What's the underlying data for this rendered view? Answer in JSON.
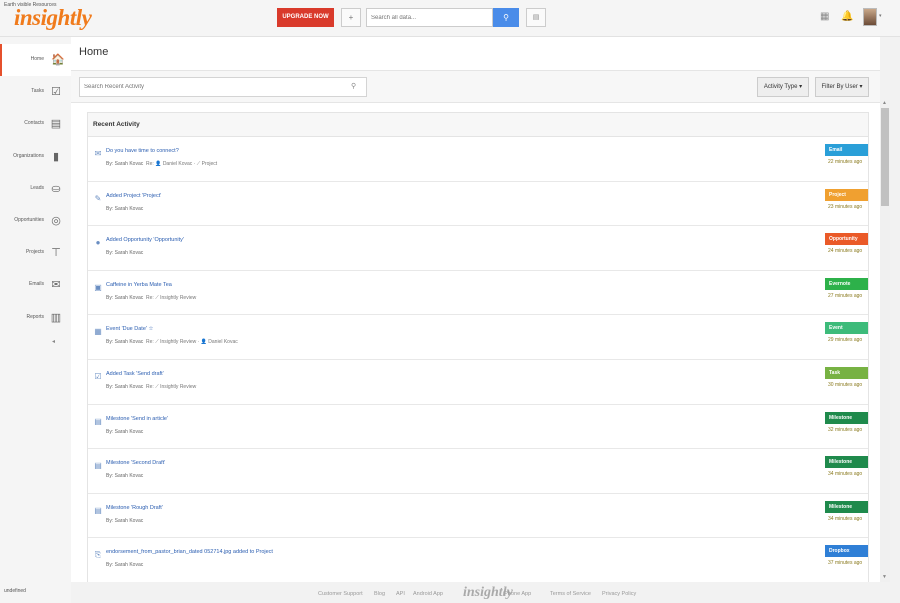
{
  "app": {
    "logo_text": "insightly",
    "top_caption": "Earth visible Resources",
    "upgrade_label": "UPGRADE NOW",
    "add_label": "+",
    "search_placeholder": "Search all data...",
    "colors": {
      "brand": "#f07b1c",
      "upgrade": "#d93a2b",
      "search_button": "#4a8ce9"
    },
    "icons": [
      "plus-icon",
      "search-icon",
      "recent-items-icon",
      "calendar-icon",
      "bell-icon",
      "avatar"
    ]
  },
  "sidebar": {
    "items": [
      {
        "label": "Home",
        "icon": "🏠",
        "icon_name": "home-icon",
        "active": true
      },
      {
        "label": "Tasks",
        "icon": "☑",
        "icon_name": "tasks-icon"
      },
      {
        "label": "Contacts",
        "icon": "▤",
        "icon_name": "contacts-icon"
      },
      {
        "label": "Organizations",
        "icon": "▮",
        "icon_name": "organizations-icon"
      },
      {
        "label": "Leads",
        "icon": "⛀",
        "icon_name": "leads-icon"
      },
      {
        "label": "Opportunities",
        "icon": "◎",
        "icon_name": "opportunities-icon"
      },
      {
        "label": "Projects",
        "icon": "⊤",
        "icon_name": "projects-icon"
      },
      {
        "label": "Emails",
        "icon": "✉",
        "icon_name": "emails-icon"
      },
      {
        "label": "Reports",
        "icon": "▥",
        "icon_name": "reports-icon"
      }
    ],
    "collapse_label": "◂",
    "status_text": "undefined"
  },
  "main": {
    "title": "Home",
    "activity_search_placeholder": "Search Recent Activity",
    "activity_type_label": "Activity Type ▾",
    "filter_by_user_label": "Filter By User ▾",
    "panel_title": "Recent Activity",
    "rows": [
      {
        "icon": "✉",
        "icon_name": "email-icon",
        "title": "Do you have time to connect?",
        "meta": "By: Sarah Kovac",
        "meta_extra": "Re: 👤 Daniel Kovac · ⟋ Project",
        "badge": "Email",
        "badge_color": "#2a9fd8",
        "time": "22 minutes ago"
      },
      {
        "icon": "✎",
        "icon_name": "project-icon",
        "title": "Added Project 'Project'",
        "meta": "By: Sarah Kovac",
        "meta_extra": "",
        "badge": "Project",
        "badge_color": "#f0a030",
        "time": "23 minutes ago"
      },
      {
        "icon": "●",
        "icon_name": "opportunity-icon",
        "title": "Added Opportunity 'Opportunity'",
        "meta": "By: Sarah Kovac",
        "meta_extra": "",
        "badge": "Opportunity",
        "badge_color": "#ea5a28",
        "time": "24 minutes ago"
      },
      {
        "icon": "▣",
        "icon_name": "evernote-icon",
        "title": "Caffeine in Yerba Mate Tea",
        "meta": "By: Sarah Kovac",
        "meta_extra": "Re: ⟋ Insightly Review",
        "badge": "Evernote",
        "badge_color": "#2db14a",
        "time": "27 minutes ago"
      },
      {
        "icon": "▦",
        "icon_name": "event-icon",
        "title": "Event 'Due Date' ☆",
        "meta": "By: Sarah Kovac",
        "meta_extra": "Re: ⟋ Insightly Review · 👤 Daniel Kovac",
        "badge": "Event",
        "badge_color": "#3dbb7a",
        "time": "29 minutes ago"
      },
      {
        "icon": "☑",
        "icon_name": "task-icon",
        "title": "Added Task 'Send draft'",
        "meta": "By: Sarah Kovac",
        "meta_extra": "Re: ⟋ Insightly Review",
        "badge": "Task",
        "badge_color": "#77b243",
        "time": "30 minutes ago"
      },
      {
        "icon": "▤",
        "icon_name": "milestone-icon",
        "title": "Milestone 'Send in article'",
        "meta": "By: Sarah Kovac",
        "meta_extra": "",
        "badge": "Milestone",
        "badge_color": "#1f8a4c",
        "time": "32 minutes ago"
      },
      {
        "icon": "▤",
        "icon_name": "milestone-icon",
        "title": "Milestone 'Second Draft'",
        "meta": "By: Sarah Kovac",
        "meta_extra": "",
        "badge": "Milestone",
        "badge_color": "#1f8a4c",
        "time": "34 minutes ago"
      },
      {
        "icon": "▤",
        "icon_name": "milestone-icon",
        "title": "Milestone 'Rough Draft'",
        "meta": "By: Sarah Kovac",
        "meta_extra": "",
        "badge": "Milestone",
        "badge_color": "#1f8a4c",
        "time": "34 minutes ago"
      },
      {
        "icon": "⎘",
        "icon_name": "dropbox-icon",
        "title": "endorsement_from_pastor_brian_dated 052714.jpg added to Project",
        "meta": "By: Sarah Kovac",
        "meta_extra": "",
        "badge": "Dropbox",
        "badge_color": "#2f7fd6",
        "time": "37 minutes ago"
      }
    ]
  },
  "footer": {
    "links": [
      "Customer Support",
      "Blog",
      "API",
      "Android App",
      "iPhone App",
      "Terms of Service",
      "Privacy Policy"
    ],
    "logo_text": "insightly"
  }
}
